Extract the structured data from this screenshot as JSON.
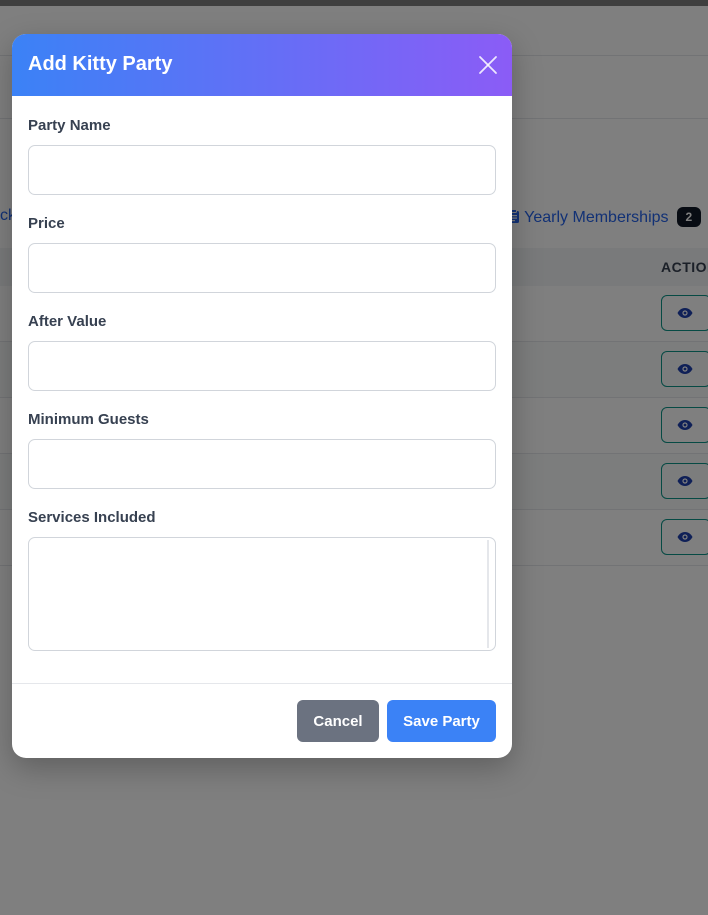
{
  "background": {
    "tab_left_fragment": "cka",
    "tab_right": {
      "icon": "clipboard-icon",
      "label": "Yearly Memberships",
      "badge": "2"
    },
    "table": {
      "action_header": "ACTION",
      "rows": 5,
      "row_action_icon": "eye-icon"
    }
  },
  "modal": {
    "title": "Add Kitty Party",
    "close_icon": "close-icon",
    "fields": {
      "party_name": {
        "label": "Party Name",
        "value": ""
      },
      "price": {
        "label": "Price",
        "value": ""
      },
      "after_value": {
        "label": "After Value",
        "value": ""
      },
      "minimum_guests": {
        "label": "Minimum Guests",
        "value": ""
      },
      "services_included": {
        "label": "Services Included",
        "value": ""
      }
    },
    "buttons": {
      "cancel": "Cancel",
      "save": "Save Party"
    }
  },
  "colors": {
    "header_gradient_start": "#3b82f6",
    "header_gradient_end": "#8b5cf6",
    "save_button": "#3b82f6",
    "cancel_button": "#6b7280",
    "overlay": "rgba(0,0,0,0.5)"
  }
}
